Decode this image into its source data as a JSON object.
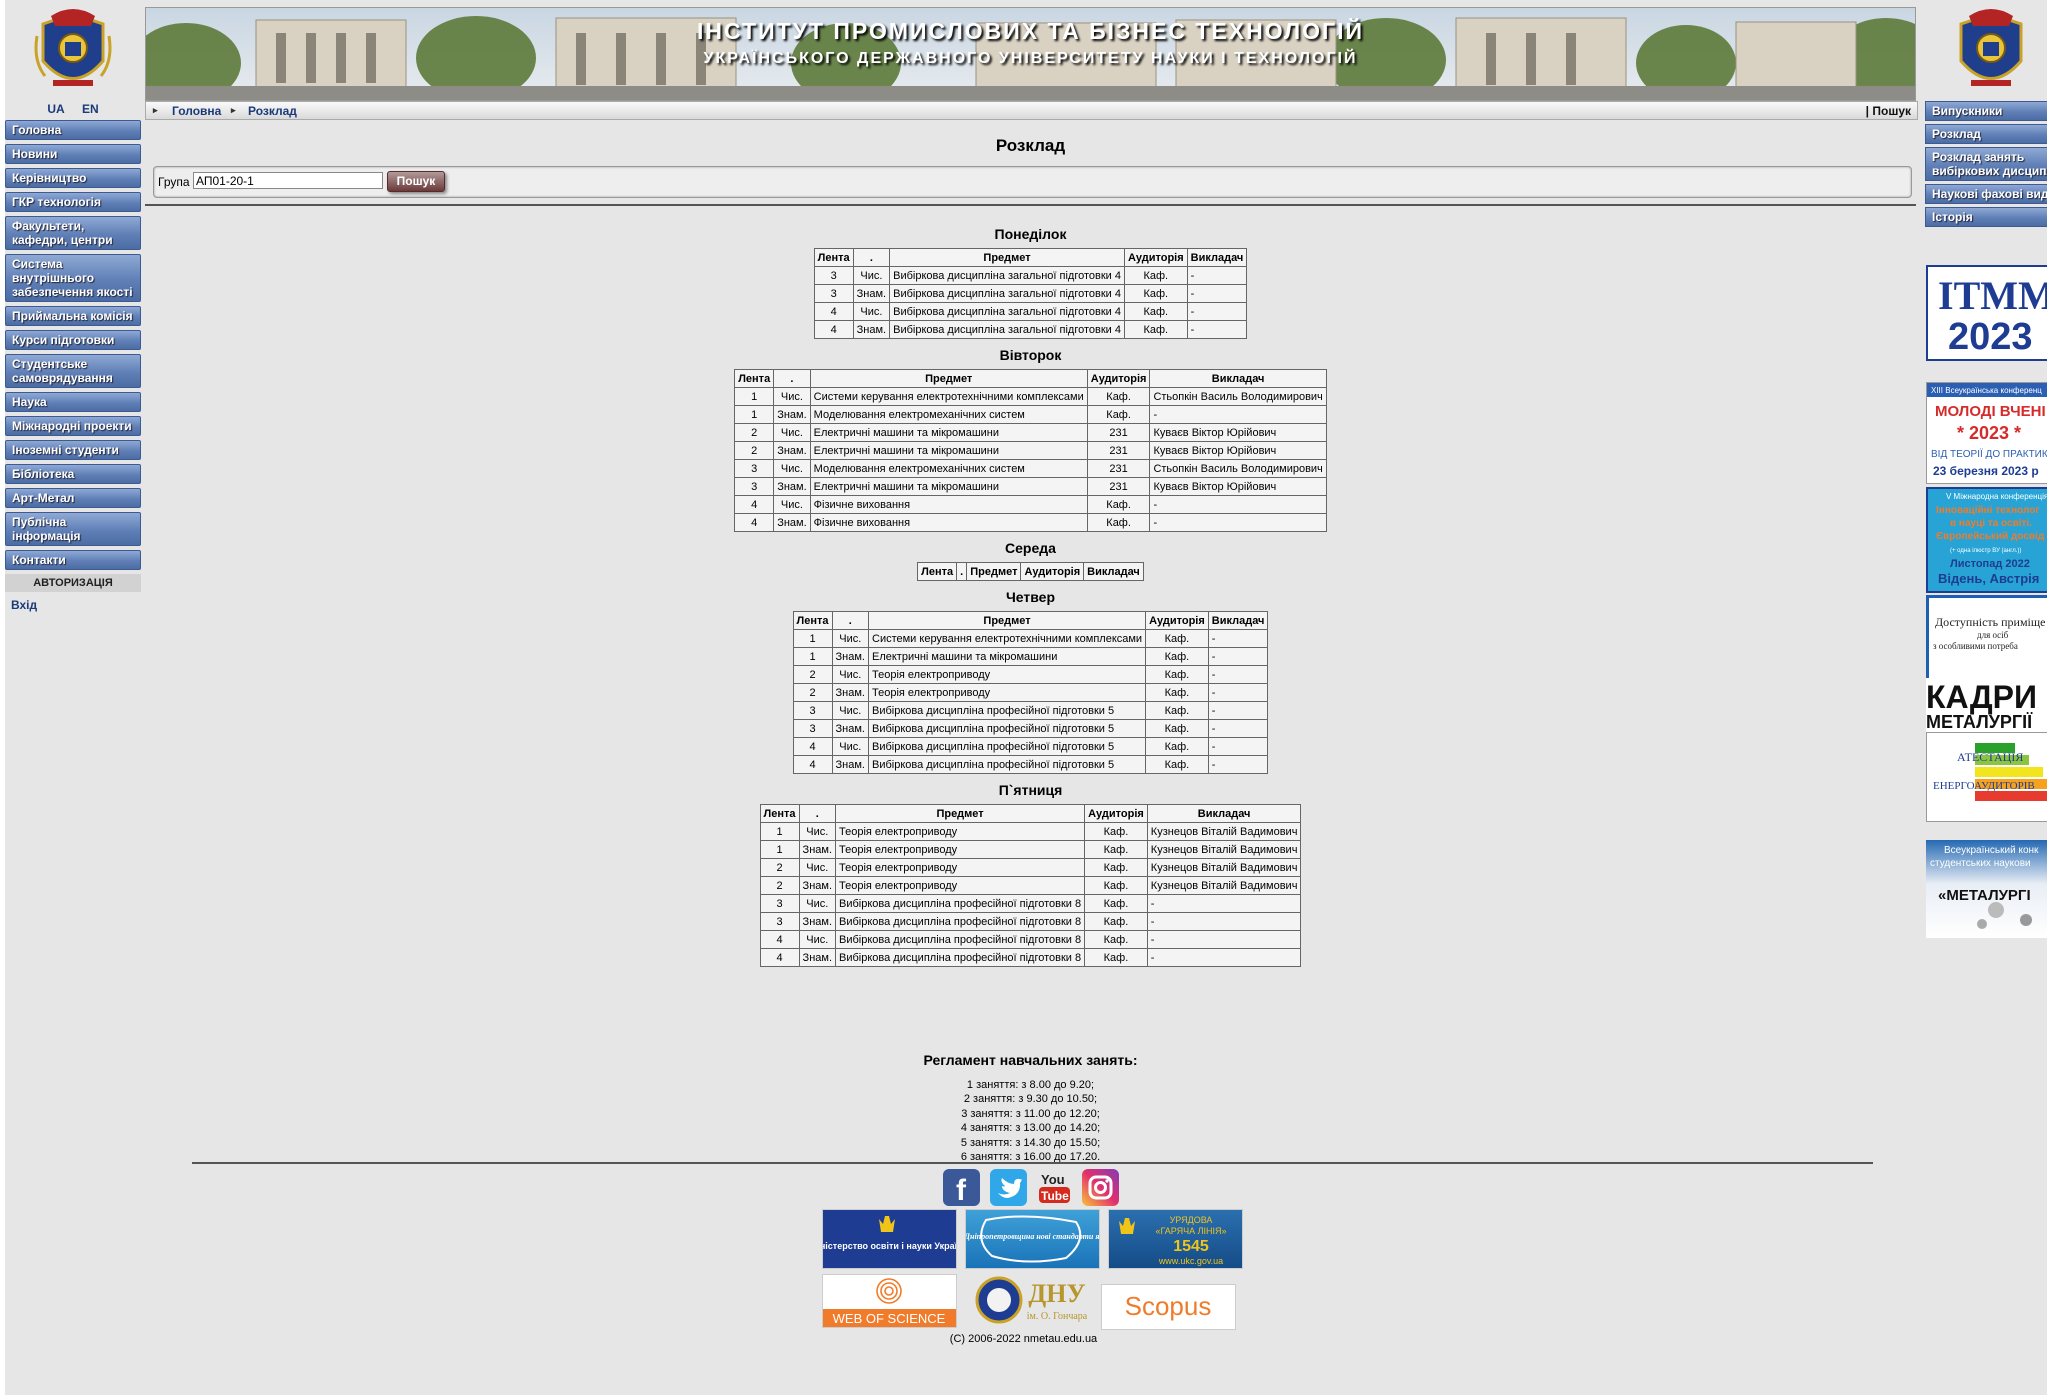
{
  "lang": {
    "ua": "UA",
    "en": "EN"
  },
  "nav": [
    "Головна",
    "Новини",
    "Керівництво",
    "ГКР технологія",
    "Факультети, кафедри, центри",
    "Система внутрішнього забезпечення якості",
    "Приймальна комісія",
    "Курси підготовки",
    "Студентське самоврядування",
    "Наука",
    "Міжнародні проекти",
    "Іноземні студенти",
    "Бібліотека",
    "Арт-Метал",
    "Публічна інформація",
    "Контакти"
  ],
  "auth": {
    "header": "АВТОРИЗАЦІЯ",
    "login": "Вхід"
  },
  "banner": {
    "title": "ІНСТИТУТ ПРОМИСЛОВИХ ТА БІЗНЕС ТЕХНОЛОГІЙ",
    "subtitle": "УКРАЇНСЬКОГО ДЕРЖАВНОГО УНІВЕРСИТЕТУ НАУКИ І ТЕХНОЛОГІЙ"
  },
  "breadcrumb": {
    "home": "Головна",
    "current": "Розклад",
    "search": "| Пошук"
  },
  "page_title": "Розклад",
  "form": {
    "label": "Група",
    "value": "АП01-20-1",
    "button": "Пошук"
  },
  "table_headers": {
    "lenta": "Лента",
    "dot": ".",
    "subject": "Предмет",
    "room": "Аудиторія",
    "teacher": "Викладач"
  },
  "days": [
    {
      "name": "Понеділок",
      "rows": [
        [
          "3",
          "Чис.",
          "Вибіркова дисципліна загальної підготовки 4",
          "Каф.",
          "-"
        ],
        [
          "3",
          "Знам.",
          "Вибіркова дисципліна загальної підготовки 4",
          "Каф.",
          "-"
        ],
        [
          "4",
          "Чис.",
          "Вибіркова дисципліна загальної підготовки 4",
          "Каф.",
          "-"
        ],
        [
          "4",
          "Знам.",
          "Вибіркова дисципліна загальної підготовки 4",
          "Каф.",
          "-"
        ]
      ]
    },
    {
      "name": "Вівторок",
      "rows": [
        [
          "1",
          "Чис.",
          "Системи керування електротехнічними комплексами",
          "Каф.",
          "Стьопкін Василь Володимирович"
        ],
        [
          "1",
          "Знам.",
          "Моделювання електромеханічних систем",
          "Каф.",
          "-"
        ],
        [
          "2",
          "Чис.",
          "Електричні машини та мікромашини",
          "231",
          "Куваєв Віктор Юрійович"
        ],
        [
          "2",
          "Знам.",
          "Електричні машини та мікромашини",
          "231",
          "Куваєв Віктор Юрійович"
        ],
        [
          "3",
          "Чис.",
          "Моделювання електромеханічних систем",
          "231",
          "Стьопкін Василь Володимирович"
        ],
        [
          "3",
          "Знам.",
          "Електричні машини та мікромашини",
          "231",
          "Куваєв Віктор Юрійович"
        ],
        [
          "4",
          "Чис.",
          "Фізичне виховання",
          "Каф.",
          "-"
        ],
        [
          "4",
          "Знам.",
          "Фізичне виховання",
          "Каф.",
          "-"
        ]
      ]
    },
    {
      "name": "Середа",
      "rows": []
    },
    {
      "name": "Четвер",
      "rows": [
        [
          "1",
          "Чис.",
          "Системи керування електротехнічними комплексами",
          "Каф.",
          "-"
        ],
        [
          "1",
          "Знам.",
          "Електричні машини та мікромашини",
          "Каф.",
          "-"
        ],
        [
          "2",
          "Чис.",
          "Теорія електроприводу",
          "Каф.",
          "-"
        ],
        [
          "2",
          "Знам.",
          "Теорія електроприводу",
          "Каф.",
          "-"
        ],
        [
          "3",
          "Чис.",
          "Вибіркова дисципліна професійної підготовки 5",
          "Каф.",
          "-"
        ],
        [
          "3",
          "Знам.",
          "Вибіркова дисципліна професійної підготовки 5",
          "Каф.",
          "-"
        ],
        [
          "4",
          "Чис.",
          "Вибіркова дисципліна професійної підготовки 5",
          "Каф.",
          "-"
        ],
        [
          "4",
          "Знам.",
          "Вибіркова дисципліна професійної підготовки 5",
          "Каф.",
          "-"
        ]
      ]
    },
    {
      "name": "П`ятниця",
      "rows": [
        [
          "1",
          "Чис.",
          "Теорія електроприводу",
          "Каф.",
          "Кузнецов Віталій Вадимович"
        ],
        [
          "1",
          "Знам.",
          "Теорія електроприводу",
          "Каф.",
          "Кузнецов Віталій Вадимович"
        ],
        [
          "2",
          "Чис.",
          "Теорія електроприводу",
          "Каф.",
          "Кузнецов Віталій Вадимович"
        ],
        [
          "2",
          "Знам.",
          "Теорія електроприводу",
          "Каф.",
          "Кузнецов Віталій Вадимович"
        ],
        [
          "3",
          "Чис.",
          "Вибіркова дисципліна професійної підготовки 8",
          "Каф.",
          "-"
        ],
        [
          "3",
          "Знам.",
          "Вибіркова дисципліна професійної підготовки 8",
          "Каф.",
          "-"
        ],
        [
          "4",
          "Чис.",
          "Вибіркова дисципліна професійної підготовки 8",
          "Каф.",
          "-"
        ],
        [
          "4",
          "Знам.",
          "Вибіркова дисципліна професійної підготовки 8",
          "Каф.",
          "-"
        ]
      ]
    }
  ],
  "reglament": {
    "title": "Регламент навчальних занять:",
    "items": [
      "1 заняття: з 8.00 до 9.20;",
      "2 заняття: з 9.30 до 10.50;",
      "3 заняття: з 11.00 до 12.20;",
      "4 заняття: з 13.00 до 14.20;",
      "5 заняття: з 14.30 до 15.50;",
      "6 заняття: з 16.00 до 17.20."
    ]
  },
  "footer": {
    "social": [
      "facebook-icon",
      "twitter-icon",
      "youtube-icon",
      "instagram-icon"
    ],
    "youtube_text": {
      "you": "You",
      "tube": "Tube"
    },
    "logos": {
      "mon": "Міністерство освіти і науки України",
      "dnipro": "Нова Дніпропетровщина нові стандарти якості",
      "hotline": {
        "l1": "УРЯДОВА",
        "l2": "«ГАРЯЧА ЛІНІЯ»",
        "l3": "1545",
        "l4": "www.ukc.gov.ua"
      },
      "wos": "WEB OF SCIENCE",
      "dnu": {
        "l1": "ДНУ",
        "l2": "ім. О. Гончара"
      },
      "scopus": "Scopus"
    },
    "copyright": "(C) 2006-2022 nmetau.edu.ua"
  },
  "right_nav": [
    "Випускники",
    "Розклад",
    "Розклад занять вибіркових дисциплін",
    "Наукові фахові видання",
    "Історія"
  ],
  "right_banners": {
    "itmm": {
      "l1": "ITMM",
      "l2": "2023"
    },
    "young": {
      "l1": "XIII Всеукраїнська конференц",
      "l2": "МОЛОДІ ВЧЕНІ",
      "l3": "* 2023 *",
      "l4": "ВІД ТЕОРІЇ ДО ПРАКТИК",
      "l5": "23 березня 2023 р"
    },
    "intl": {
      "l1": "V Міжнародна конференція",
      "l2": "Інноваційні технолог",
      "l3": "в науці та освіті.",
      "l4": "Європейський досвід",
      "l5": "(+ одна ілюстр ВУ (англ.))",
      "l6": "Листопад 2022",
      "l7": "Відень, Австрія"
    },
    "access": {
      "l1": "Доступність приміще",
      "l2": "для осіб",
      "l3": "з особливими потреба"
    },
    "kadry": {
      "l1": "КАДРИ",
      "l2": "МЕТАЛУРГІЇ"
    },
    "attest": {
      "l1": "АТЕСТАЦІЯ",
      "l2": "ЕНЕРГОАУДИТОРІВ"
    },
    "contest": {
      "l1": "Всеукраїнський конк",
      "l2": "студентських наукови",
      "l3": "«МЕТАЛУРГІ"
    }
  }
}
